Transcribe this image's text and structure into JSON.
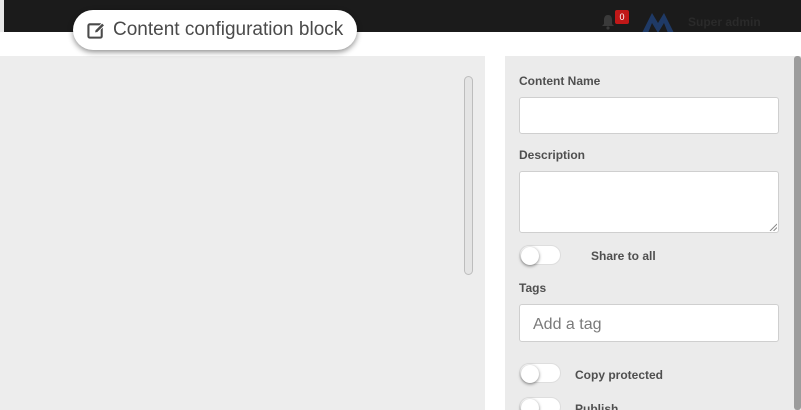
{
  "header": {
    "username": "Super admin",
    "notification_count": "0",
    "icons": [
      "bell-icon",
      "avatar-logo"
    ]
  },
  "dialog": {
    "title": "Content configuration block",
    "title_icon": "edit-icon"
  },
  "form": {
    "content_name_label": "Content Name",
    "content_name_value": "",
    "description_label": "Description",
    "description_value": "",
    "share_label": "Share to all",
    "share_on": false,
    "tags_label": "Tags",
    "tags_placeholder": "Add a tag",
    "copy_protected_label": "Copy protected",
    "copy_protected_on": false,
    "publish_label": "Publish",
    "publish_on": false
  },
  "colors": {
    "topbar": "#1b1b1b",
    "panel": "#ebebeb",
    "badge": "#c01818"
  }
}
